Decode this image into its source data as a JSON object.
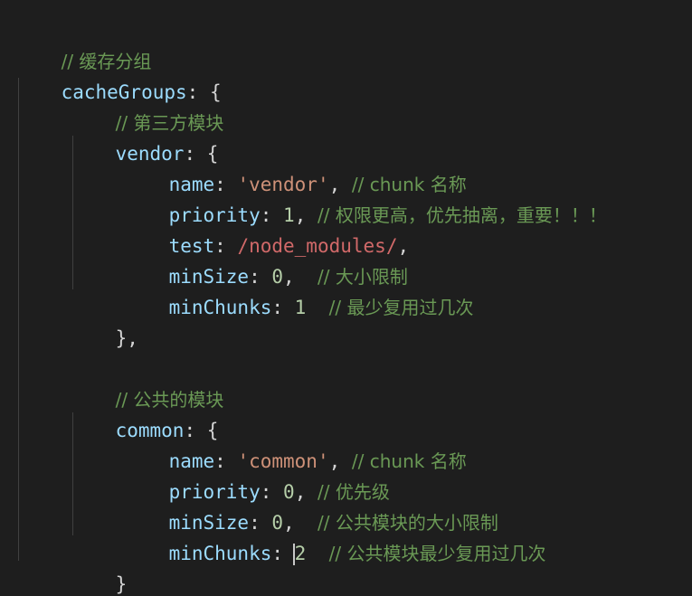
{
  "editor": {
    "lines": [
      {
        "comment": "// 缓存分组"
      },
      {
        "key": "cacheGroups",
        "open": ": {"
      },
      {
        "comment": "// 第三方模块"
      },
      {
        "key": "vendor",
        "open": ": {"
      },
      {
        "key": "name",
        "sep": ": ",
        "value": "'vendor'",
        "after": ", ",
        "comment": "// chunk 名称"
      },
      {
        "key": "priority",
        "sep": ": ",
        "value": "1",
        "after": ", ",
        "comment": "// 权限更高，优先抽离，重要！！！"
      },
      {
        "key": "test",
        "sep": ": ",
        "value": "/node_modules/",
        "after": ","
      },
      {
        "key": "minSize",
        "sep": ": ",
        "value": "0",
        "after": ",  ",
        "comment": "// 大小限制"
      },
      {
        "key": "minChunks",
        "sep": ": ",
        "value": "1",
        "after": "  ",
        "comment": "// 最少复用过几次"
      },
      {
        "close": "},"
      },
      {
        "comment": "// 公共的模块"
      },
      {
        "key": "common",
        "open": ": {"
      },
      {
        "key": "name",
        "sep": ": ",
        "value": "'common'",
        "after": ", ",
        "comment": "// chunk 名称"
      },
      {
        "key": "priority",
        "sep": ": ",
        "value": "0",
        "after": ", ",
        "comment": "// 优先级"
      },
      {
        "key": "minSize",
        "sep": ": ",
        "value": "0",
        "after": ",  ",
        "comment": "// 公共模块的大小限制"
      },
      {
        "key": "minChunks",
        "sep": ": ",
        "value": "2",
        "after": "  ",
        "comment": "// 公共模块最少复用过几次"
      },
      {
        "close": "}"
      },
      {
        "close": "}"
      }
    ]
  },
  "colors": {
    "background": "#1e1e1e",
    "comment": "#6a9955",
    "property": "#9cdcfe",
    "string": "#ce9178",
    "number": "#b5cea8",
    "regex": "#d16969",
    "punctuation": "#d4d4d4"
  }
}
